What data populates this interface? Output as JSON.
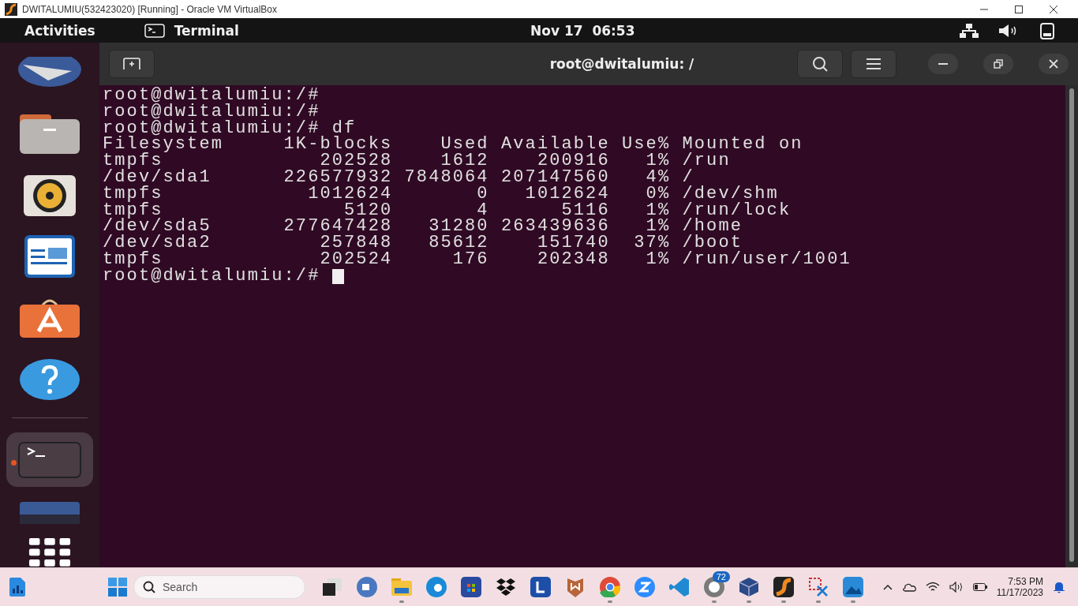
{
  "host_window": {
    "title": "DWITALUMIU(532423020) [Running] - Oracle VM VirtualBox"
  },
  "top_bar": {
    "activities": "Activities",
    "app_name": "Terminal",
    "clock": "Nov 17  06:53"
  },
  "dock": {
    "items": [
      {
        "kind": "wallpaper",
        "running": false
      },
      {
        "kind": "files",
        "running": false
      },
      {
        "kind": "music",
        "running": false
      },
      {
        "kind": "writer",
        "running": false
      },
      {
        "kind": "software",
        "running": false
      },
      {
        "kind": "help",
        "running": false
      },
      {
        "kind": "terminal",
        "running": true
      },
      {
        "kind": "disk",
        "running": false
      }
    ]
  },
  "terminal": {
    "title": "root@dwitalumiu: /",
    "lines": [
      "root@dwitalumiu:/#",
      "root@dwitalumiu:/#",
      "root@dwitalumiu:/# df",
      "Filesystem     1K-blocks    Used Available Use% Mounted on",
      "tmpfs             202528    1612    200916   1% /run",
      "/dev/sda1      226577932 7848064 207147560   4% /",
      "tmpfs            1012624       0   1012624   0% /dev/shm",
      "tmpfs               5120       4      5116   1% /run/lock",
      "/dev/sda5      277647428   31280 263439636   1% /home",
      "/dev/sda2         257848   85612    151740  37% /boot",
      "tmpfs             202524     176    202348   1% /run/user/1001",
      "root@dwitalumiu:/#"
    ]
  },
  "taskbar": {
    "search": {
      "placeholder": "Search"
    },
    "apps": [
      {
        "kind": "taskview",
        "running": false
      },
      {
        "kind": "meet",
        "running": false
      },
      {
        "kind": "folder",
        "running": true
      },
      {
        "kind": "edge",
        "running": false
      },
      {
        "kind": "store",
        "running": false
      },
      {
        "kind": "dropbox",
        "running": false
      },
      {
        "kind": "letter",
        "running": false
      },
      {
        "kind": "shield",
        "running": false
      },
      {
        "kind": "chrome",
        "running": true
      },
      {
        "kind": "zoom",
        "running": false
      },
      {
        "kind": "code",
        "running": false
      },
      {
        "kind": "chat",
        "running": true,
        "badge": "72"
      },
      {
        "kind": "cube",
        "running": true
      },
      {
        "kind": "orange",
        "running": true
      },
      {
        "kind": "snip",
        "running": true
      },
      {
        "kind": "photos",
        "running": true
      }
    ],
    "time": "7:53 PM",
    "date": "11/17/2023"
  }
}
